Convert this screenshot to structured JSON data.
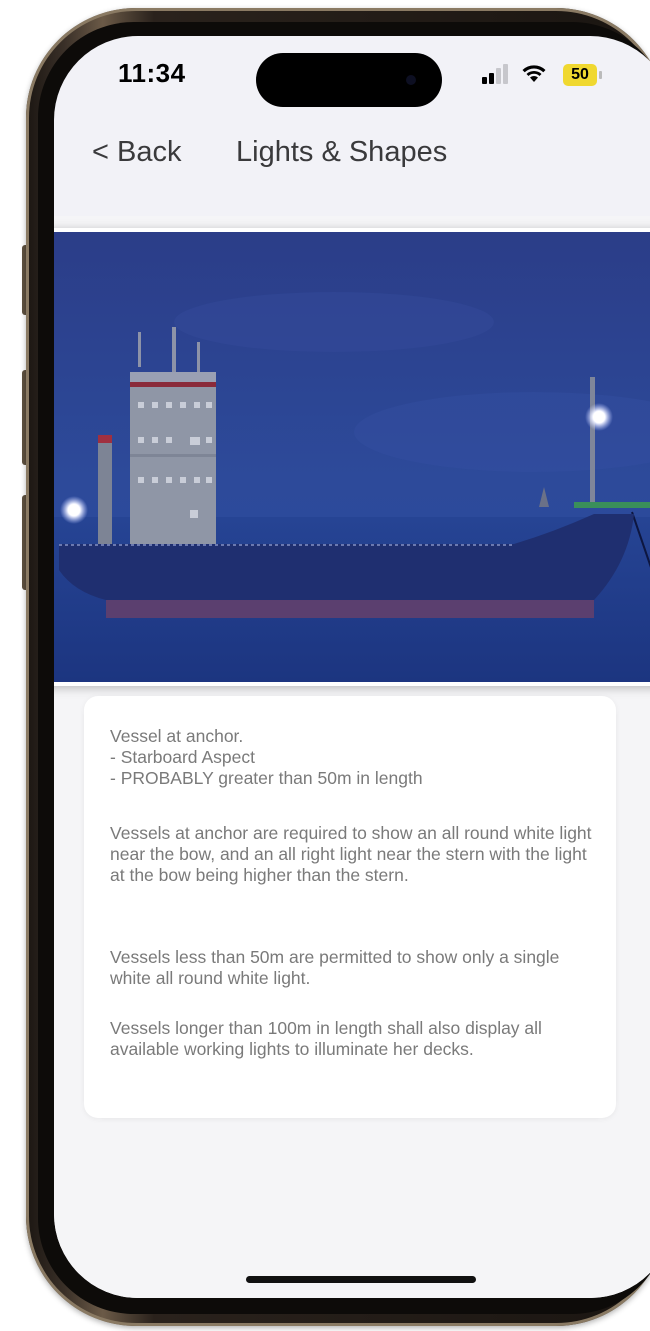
{
  "status_bar": {
    "time": "11:34",
    "battery": "50"
  },
  "nav": {
    "back_label": "< Back",
    "title": "Lights & Shapes"
  },
  "description": {
    "para1": "Vessel at anchor.\n- Starboard Aspect\n- PROBABLY greater than 50m in length",
    "para2": "Vessels at anchor are required to show an all round white light near the bow, and an all right light near the stern with the light at the bow being higher than the stern.",
    "para3": "Vessels less than 50m are permitted to show only a single white all round white light.",
    "para4": "Vessels longer than 100m in length shall also display all available working lights to illuminate her decks."
  },
  "colors": {
    "sky": "#2a3f8c",
    "sea": "#213a8a",
    "hull": "#1e2f6e",
    "boot_top": "#5a3f6e",
    "accent_yellow": "#f0d830"
  },
  "icons": [
    "signal-icon",
    "wifi-icon",
    "battery-icon",
    "white-light-icon"
  ]
}
